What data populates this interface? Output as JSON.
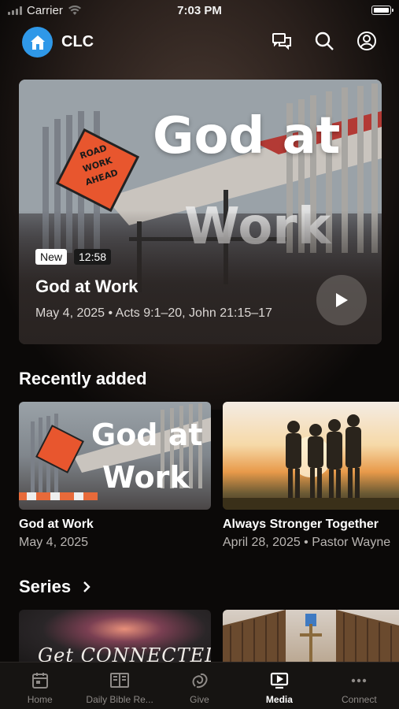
{
  "status_bar": {
    "carrier": "Carrier",
    "time": "7:03 PM"
  },
  "header": {
    "app_name": "CLC",
    "icons": [
      "messages-icon",
      "search-icon",
      "account-icon"
    ]
  },
  "hero": {
    "art_title_line1": "God at",
    "art_title_line2": "Work",
    "sign_text": "ROAD WORK AHEAD",
    "badge_new": "New",
    "duration": "12:58",
    "title": "God at Work",
    "meta": "May 4, 2025 • Acts 9:1–20, John 21:15–17"
  },
  "recently_added": {
    "heading": "Recently added",
    "items": [
      {
        "art_line1": "God at",
        "art_line2": "Work",
        "title": "God at Work",
        "subtitle": "May 4, 2025"
      },
      {
        "title": "Always Stronger Together",
        "subtitle": "April 28, 2025 • Pastor Wayne"
      }
    ]
  },
  "series": {
    "heading": "Series",
    "first_art_text": "Get CONNECTED"
  },
  "tabbar": {
    "tabs": [
      {
        "label": "Home",
        "icon": "calendar-icon"
      },
      {
        "label": "Daily Bible Re...",
        "icon": "book-icon"
      },
      {
        "label": "Give",
        "icon": "give-icon"
      },
      {
        "label": "Media",
        "icon": "media-icon",
        "active": true
      },
      {
        "label": "Connect",
        "icon": "more-icon"
      }
    ]
  },
  "colors": {
    "accent": "#2f98e8",
    "background": "#0b0908"
  }
}
